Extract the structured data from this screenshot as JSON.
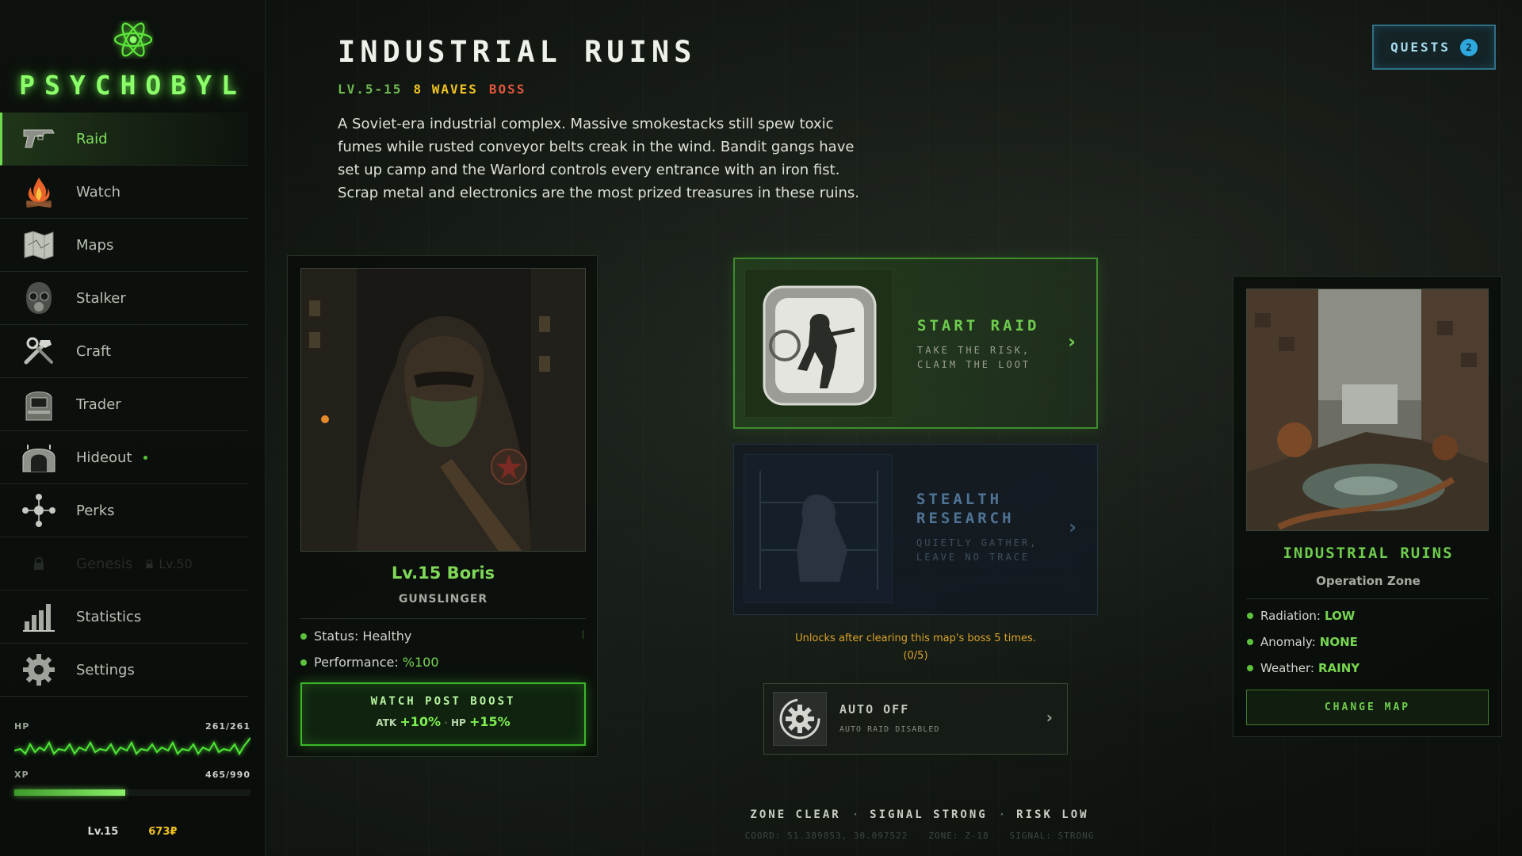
{
  "app": {
    "title": "PSYCHOBYL"
  },
  "sidebar": {
    "items": [
      {
        "label": "Raid",
        "icon": "pistol-icon",
        "active": true
      },
      {
        "label": "Watch",
        "icon": "campfire-icon"
      },
      {
        "label": "Maps",
        "icon": "map-icon"
      },
      {
        "label": "Stalker",
        "icon": "gasmask-icon"
      },
      {
        "label": "Craft",
        "icon": "tools-icon"
      },
      {
        "label": "Trader",
        "icon": "trader-booth-icon"
      },
      {
        "label": "Hideout",
        "icon": "bunker-icon",
        "notification": true
      },
      {
        "label": "Perks",
        "icon": "perks-icon"
      },
      {
        "label": "Genesis",
        "icon": "lock-icon",
        "locked": true,
        "lock_level": "Lv.50"
      },
      {
        "label": "Statistics",
        "icon": "bar-chart-icon"
      },
      {
        "label": "Settings",
        "icon": "gear-icon"
      }
    ],
    "hp": {
      "label": "HP",
      "value": "261/261",
      "current": 261,
      "max": 261
    },
    "xp": {
      "label": "XP",
      "value": "465/990",
      "current": 465,
      "max": 990
    },
    "level": "Lv.15",
    "currency": "673₽"
  },
  "header": {
    "title": "INDUSTRIAL RUINS",
    "level_range": "LV.5-15",
    "waves": "8 WAVES",
    "boss": "BOSS",
    "description": "A Soviet-era industrial complex. Massive smokestacks still spew toxic fumes while rusted conveyor belts creak in the wind. Bandit gangs have set up camp and the Warlord controls every entrance with an iron fist. Scrap metal and electronics are the most prized treasures in these ruins."
  },
  "quests": {
    "label": "QUESTS",
    "count": "2"
  },
  "character": {
    "name": "Lv.15 Boris",
    "class": "GUNSLINGER",
    "status_label": "Status:",
    "status_value": "Healthy",
    "performance_label": "Performance:",
    "performance_value": "%100",
    "boost_title": "WATCH POST BOOST",
    "boost_atk_label": "ATK",
    "boost_atk_value": "+10%",
    "boost_hp_label": "HP",
    "boost_hp_value": "+15%"
  },
  "actions": {
    "start_raid": {
      "title": "START RAID",
      "subtitle": "TAKE THE RISK, CLAIM THE LOOT"
    },
    "stealth": {
      "title": "STEALTH RESEARCH",
      "subtitle": "QUIETLY GATHER, LEAVE NO TRACE"
    },
    "unlock_note": "Unlocks after clearing this map's boss 5 times.",
    "unlock_progress": "(0/5)",
    "auto": {
      "title": "AUTO OFF",
      "subtitle": "AUTO RAID DISABLED"
    }
  },
  "map": {
    "name": "INDUSTRIAL RUINS",
    "subtitle": "Operation Zone",
    "radiation_label": "Radiation:",
    "radiation_value": "LOW",
    "anomaly_label": "Anomaly:",
    "anomaly_value": "NONE",
    "weather_label": "Weather:",
    "weather_value": "RAINY",
    "change_label": "CHANGE MAP"
  },
  "footer": {
    "status1": "ZONE CLEAR",
    "status2": "SIGNAL STRONG",
    "status3": "RISK LOW",
    "coord": "COORD: 51.389853, 30.097522",
    "zone": "ZONE: Z-18",
    "signal": "SIGNAL: STRONG"
  },
  "colors": {
    "accent": "#6fcc4e",
    "gold": "#f0c323",
    "danger": "#e0563f",
    "quest": "#2ea7dc"
  }
}
